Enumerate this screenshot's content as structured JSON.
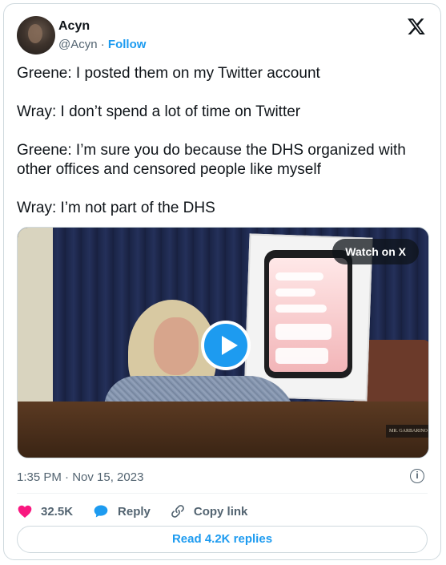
{
  "author": {
    "name": "Acyn",
    "handle": "@Acyn",
    "separator": "·",
    "follow_label": "Follow"
  },
  "tweet": {
    "paragraphs": [
      "Greene: I posted them on my Twitter account",
      "Wray: I don’t spend a lot of time on Twitter",
      "Greene: I’m sure you do because the DHS organized with other offices and censored people like myself",
      "Wray: I’m not part of the DHS"
    ]
  },
  "media": {
    "watch_label": "Watch on X",
    "nameplate": "MR. GARBARINO"
  },
  "meta": {
    "timestamp": "1:35 PM · Nov 15, 2023",
    "info_glyph": "i"
  },
  "actions": {
    "likes_count": "32.5K",
    "reply_label": "Reply",
    "copy_label": "Copy link"
  },
  "footer": {
    "read_replies_label": "Read 4.2K replies"
  },
  "colors": {
    "accent": "#1d9bf0",
    "heart": "#f91880",
    "secondary_text": "#536471",
    "border": "#cfd9de"
  },
  "icons": [
    "x-logo-icon",
    "play-icon",
    "info-icon",
    "heart-icon",
    "reply-bubble-icon",
    "link-icon"
  ]
}
